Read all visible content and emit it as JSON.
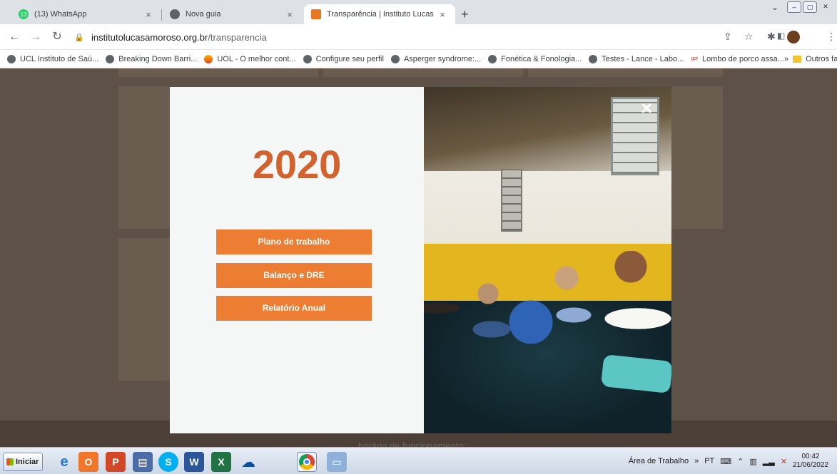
{
  "browser": {
    "tabs": [
      {
        "title": "(13) WhatsApp",
        "badge": "13",
        "icon": "whatsapp-icon"
      },
      {
        "title": "Nova guia",
        "icon": "globe-icon"
      },
      {
        "title": "Transparência | Instituto Lucas",
        "icon": "site-favicon",
        "active": true
      }
    ],
    "url_host": "institutolucasamoroso.org.br",
    "url_path": "/transparencia",
    "bookmarks": [
      {
        "label": "UCL Instituto de Saú...",
        "icon": "globe-icon"
      },
      {
        "label": "Breaking Down Barri...",
        "icon": "globe-icon"
      },
      {
        "label": "UOL - O melhor cont...",
        "icon": "uol-icon"
      },
      {
        "label": "Configure seu perfil",
        "icon": "globe-icon"
      },
      {
        "label": "Asperger syndrome:...",
        "icon": "globe-icon"
      },
      {
        "label": "Fonética & Fonologia...",
        "icon": "globe-icon"
      },
      {
        "label": "Testes - Lance - Labo...",
        "icon": "globe-icon"
      },
      {
        "label": "Lombo de porco assa...",
        "icon": "gpt-icon",
        "prefix": "gpt"
      }
    ],
    "bookmarks_more": "»",
    "other_bookmarks": "Outros favoritos"
  },
  "modal": {
    "year": "2020",
    "buttons": [
      "Plano de trabalho",
      "Balanço e DRE",
      "Relatório Anual"
    ],
    "close_glyph": "×"
  },
  "page": {
    "footer_text": "horário de funcionamento:"
  },
  "taskbar": {
    "start_label": "Iniciar",
    "desktop_label": "Área de Trabalho",
    "language": "PT",
    "time": "00:42",
    "date": "21/06/2022"
  }
}
